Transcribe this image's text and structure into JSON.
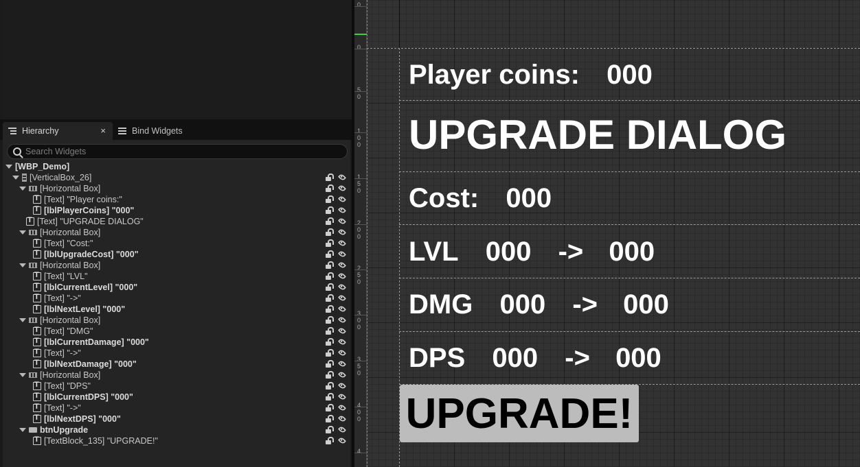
{
  "tabs": {
    "hierarchy": "Hierarchy",
    "bind_widgets": "Bind Widgets",
    "close": "×"
  },
  "search": {
    "placeholder": "Search Widgets"
  },
  "tree": [
    {
      "label": "[WBP_Demo]",
      "depth": 0,
      "icon": "",
      "expand": true,
      "bold": true,
      "controls": false
    },
    {
      "label": "[VerticalBox_26]",
      "depth": 1,
      "icon": "vbox",
      "expand": true,
      "bold": false,
      "controls": true
    },
    {
      "label": "[Horizontal Box]",
      "depth": 2,
      "icon": "hbox",
      "expand": true,
      "bold": false,
      "controls": true
    },
    {
      "label": "[Text] \"Player coins:\"",
      "depth": 3,
      "icon": "text",
      "expand": false,
      "bold": false,
      "controls": true
    },
    {
      "label": "[lblPlayerCoins] \"000\"",
      "depth": 3,
      "icon": "text",
      "expand": false,
      "bold": true,
      "controls": true
    },
    {
      "label": "[Text] \"UPGRADE DIALOG\"",
      "depth": 2,
      "icon": "text",
      "expand": false,
      "bold": false,
      "controls": true
    },
    {
      "label": "[Horizontal Box]",
      "depth": 2,
      "icon": "hbox",
      "expand": true,
      "bold": false,
      "controls": true
    },
    {
      "label": "[Text] \"Cost:\"",
      "depth": 3,
      "icon": "text",
      "expand": false,
      "bold": false,
      "controls": true
    },
    {
      "label": "[lblUpgradeCost] \"000\"",
      "depth": 3,
      "icon": "text",
      "expand": false,
      "bold": true,
      "controls": true
    },
    {
      "label": "[Horizontal Box]",
      "depth": 2,
      "icon": "hbox",
      "expand": true,
      "bold": false,
      "controls": true
    },
    {
      "label": "[Text] \"LVL\"",
      "depth": 3,
      "icon": "text",
      "expand": false,
      "bold": false,
      "controls": true
    },
    {
      "label": "[lblCurrentLevel] \"000\"",
      "depth": 3,
      "icon": "text",
      "expand": false,
      "bold": true,
      "controls": true
    },
    {
      "label": "[Text] \"->\"",
      "depth": 3,
      "icon": "text",
      "expand": false,
      "bold": false,
      "controls": true
    },
    {
      "label": "[lblNextLevel] \"000\"",
      "depth": 3,
      "icon": "text",
      "expand": false,
      "bold": true,
      "controls": true
    },
    {
      "label": "[Horizontal Box]",
      "depth": 2,
      "icon": "hbox",
      "expand": true,
      "bold": false,
      "controls": true
    },
    {
      "label": "[Text] \"DMG\"",
      "depth": 3,
      "icon": "text",
      "expand": false,
      "bold": false,
      "controls": true
    },
    {
      "label": "[lblCurrentDamage] \"000\"",
      "depth": 3,
      "icon": "text",
      "expand": false,
      "bold": true,
      "controls": true
    },
    {
      "label": "[Text] \"->\"",
      "depth": 3,
      "icon": "text",
      "expand": false,
      "bold": false,
      "controls": true
    },
    {
      "label": "[lblNextDamage] \"000\"",
      "depth": 3,
      "icon": "text",
      "expand": false,
      "bold": true,
      "controls": true
    },
    {
      "label": "[Horizontal Box]",
      "depth": 2,
      "icon": "hbox",
      "expand": true,
      "bold": false,
      "controls": true
    },
    {
      "label": "[Text] \"DPS\"",
      "depth": 3,
      "icon": "text",
      "expand": false,
      "bold": false,
      "controls": true
    },
    {
      "label": "[lblCurrentDPS] \"000\"",
      "depth": 3,
      "icon": "text",
      "expand": false,
      "bold": true,
      "controls": true
    },
    {
      "label": "[Text] \"->\"",
      "depth": 3,
      "icon": "text",
      "expand": false,
      "bold": false,
      "controls": true
    },
    {
      "label": "[lblNextDPS] \"000\"",
      "depth": 3,
      "icon": "text",
      "expand": false,
      "bold": true,
      "controls": true
    },
    {
      "label": "btnUpgrade",
      "depth": 2,
      "icon": "button",
      "expand": true,
      "bold": true,
      "controls": true
    },
    {
      "label": "[TextBlock_135] \"UPGRADE!\"",
      "depth": 3,
      "icon": "text",
      "expand": false,
      "bold": false,
      "controls": true
    }
  ],
  "ruler_ticks": [
    "0",
    "0",
    "5\n0",
    "1\n0\n0",
    "1\n5\n0",
    "2\n0\n0",
    "2\n5\n0",
    "3\n0\n0",
    "3\n5\n0",
    "4\n0\n0",
    "4"
  ],
  "widget": {
    "coins_label": "Player coins:",
    "coins_value": "000",
    "title": "UPGRADE DIALOG",
    "cost_label": "Cost:",
    "cost_value": "000",
    "lvl_label": "LVL",
    "lvl_current": "000",
    "lvl_arrow": "->",
    "lvl_next": "000",
    "dmg_label": "DMG",
    "dmg_current": "000",
    "dmg_arrow": "->",
    "dmg_next": "000",
    "dps_label": "DPS",
    "dps_current": "000",
    "dps_arrow": "->",
    "dps_next": "000",
    "button_label": "UPGRADE!"
  }
}
